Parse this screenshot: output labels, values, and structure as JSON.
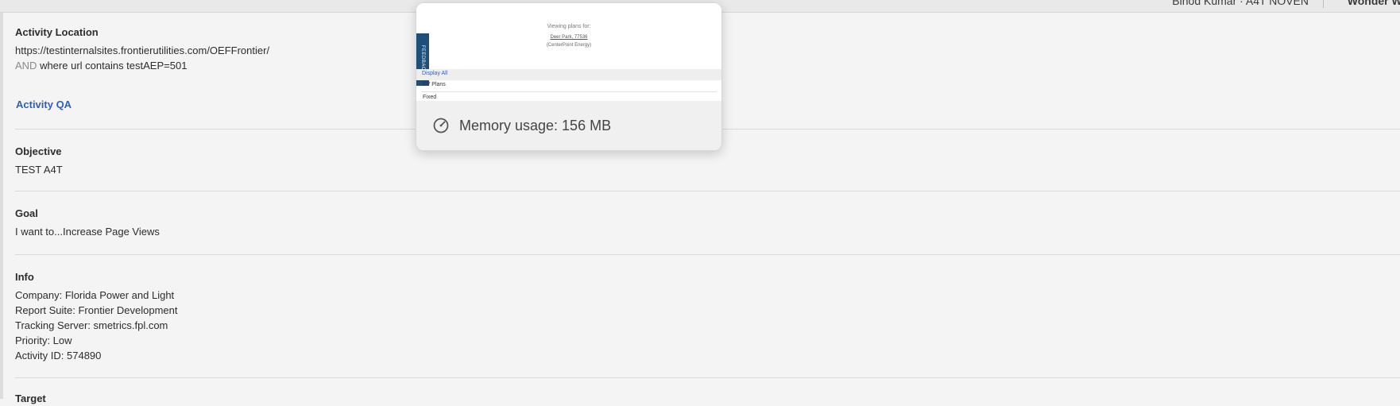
{
  "topbar": {
    "user_name": "Binod Kumar · A4T NOVEN",
    "org_name": "Wonder Wa"
  },
  "sections": {
    "activity_location": {
      "title": "Activity Location",
      "url": "https://testinternalsites.frontierutilities.com/OEFFrontier/",
      "condition_keyword": "AND",
      "condition_text": " where url contains testAEP=501"
    },
    "activity_qa": {
      "label": "Activity QA"
    },
    "objective": {
      "title": "Objective",
      "value": "TEST A4T"
    },
    "goal": {
      "title": "Goal",
      "value": "I want to...Increase Page Views"
    },
    "info": {
      "title": "Info",
      "lines": [
        "Company: Florida Power and Light",
        "Report Suite: Frontier Development",
        "Tracking Server: smetrics.fpl.com",
        "Priority: Low",
        "Activity ID: 574890"
      ]
    },
    "next": {
      "title": "Target"
    }
  },
  "popup": {
    "thumbnail": {
      "heading": "Viewing plans for:",
      "zip": "Deer Park, 77536",
      "provider": "(CenterPoint Energy)",
      "feedback_tab": "FEEDBACK",
      "row_display_all": "Display All",
      "row_ev_plans": "EV Plans",
      "row_third": "Fixed"
    },
    "memory_label": "Memory usage: 156 MB",
    "memory_icon": "gauge-icon"
  },
  "colors": {
    "link": "#2d5fbf",
    "feedback_tab": "#1f4e79",
    "background": "#f4f4f4"
  }
}
